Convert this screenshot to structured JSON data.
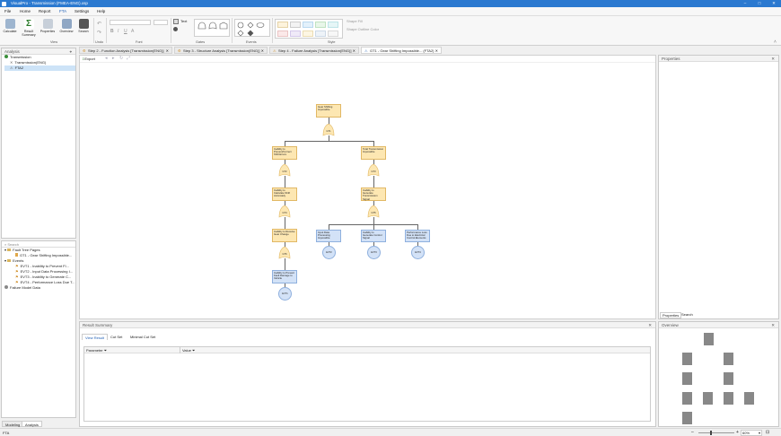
{
  "titlebar": {
    "title": "VisualPro - Transmission (FMEA-ENG).xsp",
    "min": "–",
    "max": "□",
    "close": "✕"
  },
  "menu": [
    "File",
    "Home",
    "Report",
    "FTA",
    "Settings",
    "Help"
  ],
  "ribbon": {
    "calculate": "Calculate",
    "result_summary": "Result Summary",
    "properties": "Properties",
    "overview": "Overview",
    "search": "Search",
    "groups": {
      "view": "View",
      "undo": "Undo",
      "font": "Font",
      "gates": "Gates",
      "events": "Events",
      "style": "Style"
    },
    "text": "Text",
    "shape_fill": "Shape Fill",
    "shape_outline": "Shape Outline Color"
  },
  "analysis": {
    "title": "Analysis",
    "root": "Transmission",
    "child1": "Transmission(ENG)",
    "child2": "FTA2"
  },
  "search_panel": {
    "placeholder": "Search",
    "fault_tree_pages": "Fault Tree Pages",
    "page1": "GT1 - Gear Shifting Impossible...",
    "events": "Events",
    "ev1": "EVT1 - Inability to Prevent Fl...",
    "ev2": "EVT2 - Input Data Processing I...",
    "ev3": "EVT3 - Inability to Generate C...",
    "ev4": "EVT4 - Performance Loss Due T...",
    "fmd": "Failure Model Data"
  },
  "bottom_tabs": {
    "modeling": "Modeling",
    "analysis": "Analysis"
  },
  "doc_tabs": [
    "Step 2 - Function Analysis [Transmission(ENG)]",
    "Step 3 - Structure Analysis [Transmission(ENG)]",
    "Step 4 - Failure Analysis [Transmission(ENG)]",
    "GT1 - Gear Shifting Impossible... (FTA2)"
  ],
  "canvas": {
    "export": "Export"
  },
  "tree": {
    "top": "Gear Shifting Impossible",
    "g_top": "GT1",
    "left1": "Inability to Prevent/Correct Shift Errors",
    "g_l1": "GT2",
    "left2": "Inability to Calculate Shift Accurately",
    "g_l2": "GT4",
    "left3": "Inability to Receive Gear Change",
    "g_l3": "GT6",
    "left4": "Inability to Prevent Fault Damage to Vehicle",
    "c_left": "EVT1",
    "right1": "Total Transmission Impossible",
    "g_r1": "GT3",
    "right2": "Inability to Generate Transmission Signal",
    "g_r2": "GT5",
    "b1": "Input Data Processing Impossible",
    "b2": "Inability to Generate Control Signal",
    "b3": "Performance Loss Due to Electrical Control Elements",
    "c1": "EVT2",
    "c2": "EVT3",
    "c3": "EVT4"
  },
  "result": {
    "title": "Result Summary",
    "tabs": [
      "View Result",
      "Cut Set",
      "Minimal Cut Set"
    ],
    "col1": "Parameter",
    "col2": "Value"
  },
  "properties": {
    "title": "Properties",
    "tab1": "Properties",
    "tab2": "Search"
  },
  "overview": {
    "title": "Overview",
    "zoom": "60%"
  },
  "status": {
    "left": "FTA"
  }
}
